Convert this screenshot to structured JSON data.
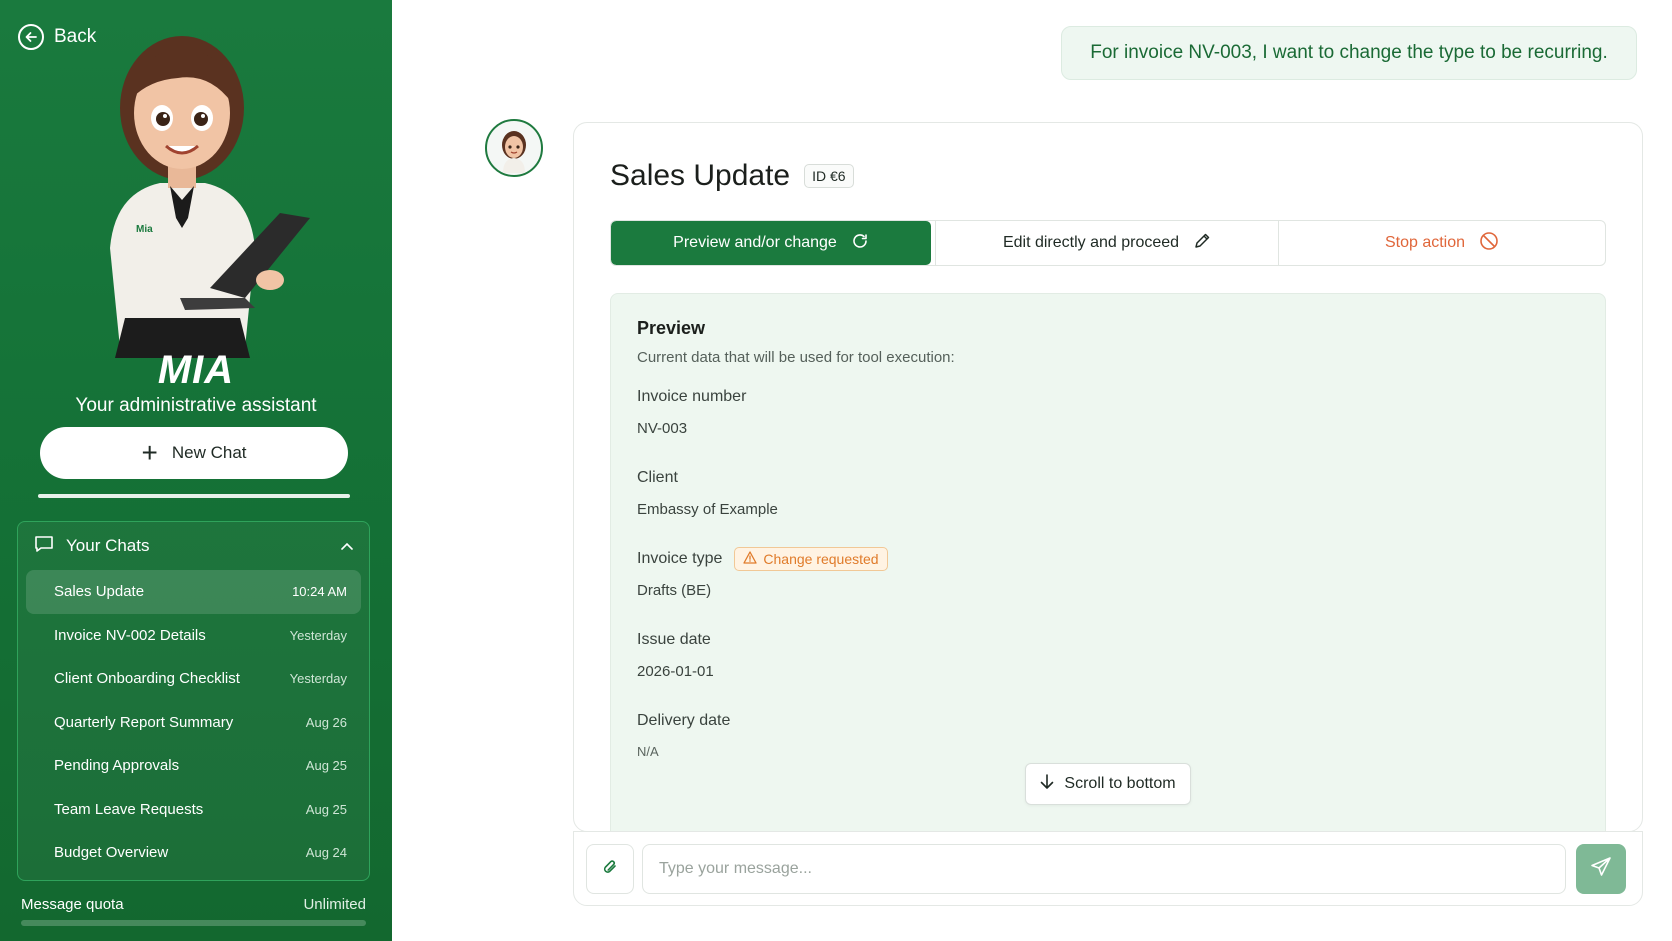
{
  "sidebar": {
    "back_label": "Back",
    "brand": "MIA",
    "badge_name": "Mia",
    "tagline": "Your administrative assistant",
    "new_chat_label": "New Chat",
    "chats_title": "Your Chats",
    "chats": [
      {
        "name": "Sales Update",
        "date": "10:24 AM",
        "active": true
      },
      {
        "name": "Invoice NV-002 Details",
        "date": "Yesterday"
      },
      {
        "name": "Client Onboarding Checklist",
        "date": "Yesterday"
      },
      {
        "name": "Quarterly Report Summary",
        "date": "Aug 26"
      },
      {
        "name": "Pending Approvals",
        "date": "Aug 25"
      },
      {
        "name": "Team Leave Requests",
        "date": "Aug 25"
      },
      {
        "name": "Budget Overview",
        "date": "Aug 24"
      }
    ],
    "quota_label": "Message quota",
    "quota_value": "Unlimited"
  },
  "conversation": {
    "user_message": "For invoice NV-003, I want to change the type to be recurring."
  },
  "card": {
    "title": "Sales Update",
    "id_badge": "ID €6",
    "actions": {
      "preview_label": "Preview and/or change",
      "edit_label": "Edit directly and proceed",
      "stop_label": "Stop action"
    },
    "preview": {
      "heading": "Preview",
      "subheading": "Current data that will be used for tool execution:",
      "change_badge": "Change requested",
      "fields": [
        {
          "label": "Invoice number",
          "value": "NV-003"
        },
        {
          "label": "Client",
          "value": "Embassy of Example"
        },
        {
          "label": "Invoice type",
          "value": "Drafts (BE)"
        },
        {
          "label": "Issue date",
          "value": "2026-01-01"
        },
        {
          "label": "Delivery date",
          "value": "N/A"
        }
      ]
    },
    "scroll_label": "Scroll to bottom"
  },
  "composer": {
    "placeholder": "Type your message..."
  },
  "colors": {
    "brand_green": "#1b7a3e",
    "warning_orange": "#e07b2a",
    "stop_red": "#e0663a"
  }
}
